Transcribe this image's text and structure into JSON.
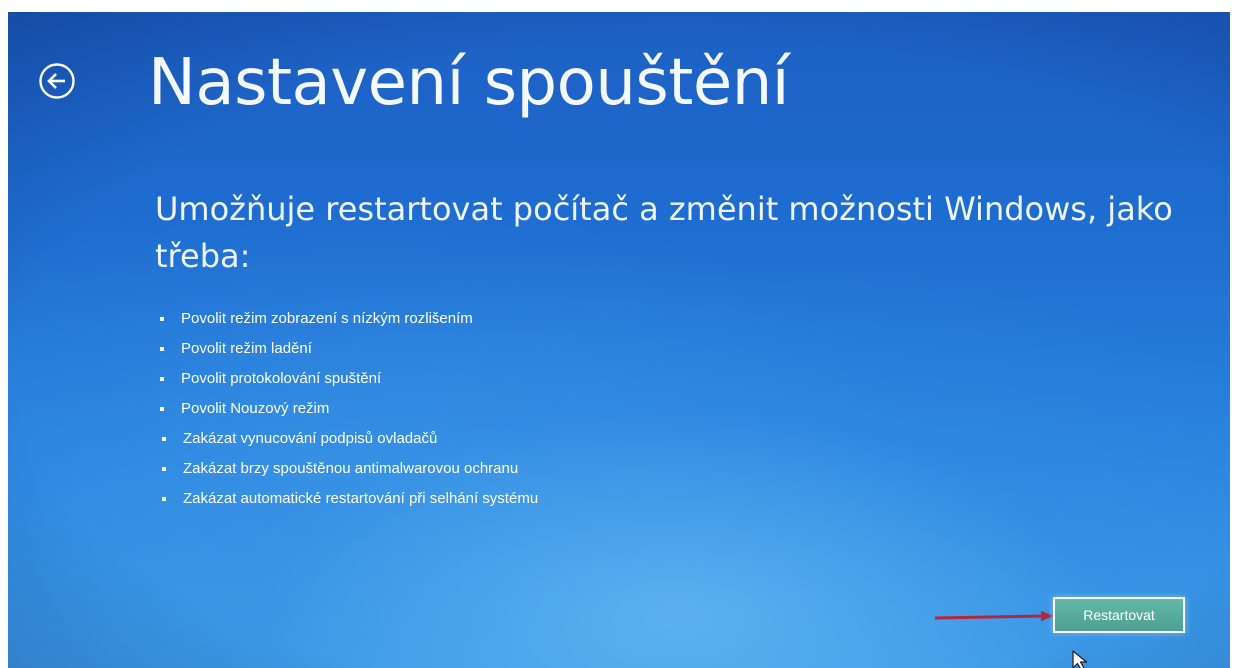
{
  "header": {
    "title": "Nastavení spouštění",
    "back_icon": "back-arrow-circle-icon"
  },
  "intro": {
    "text": "Umožňuje restartovat počítač a změnit možnosti Windows, jako třeba:"
  },
  "options": [
    "Povolit režim zobrazení s nízkým rozlišením",
    "Povolit režim ladění",
    "Povolit protokolování spuštění",
    "Povolit Nouzový režim",
    "Zakázat vynucování podpisů ovladačů",
    "Zakázat brzy spouštěnou antimalwarovou ochranu",
    "Zakázat automatické restartování při selhání systému"
  ],
  "actions": {
    "restart_label": "Restartovat"
  },
  "colors": {
    "background": "#1f6ed2",
    "annotation_arrow": "#b3263b",
    "button_fill": "#5aac9c"
  }
}
